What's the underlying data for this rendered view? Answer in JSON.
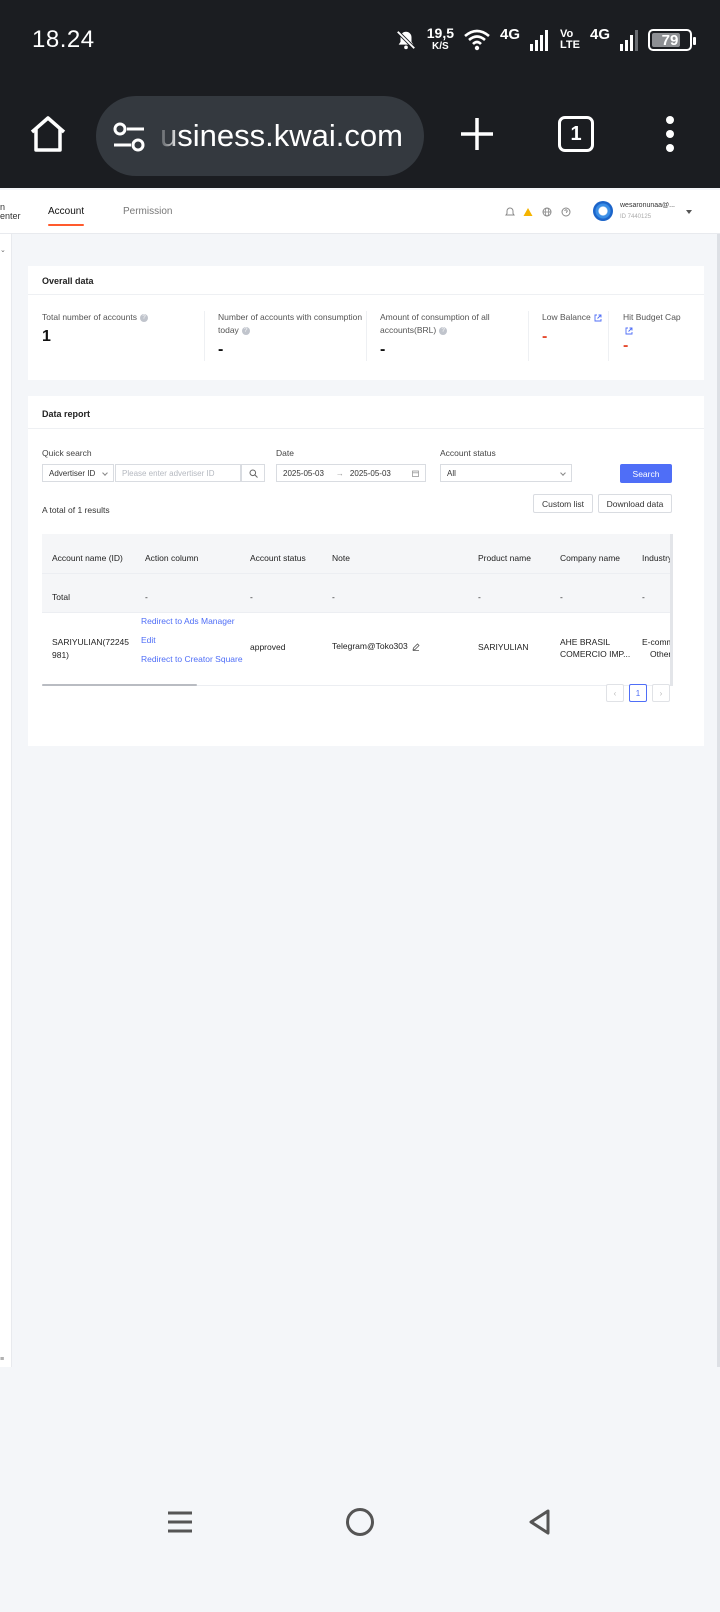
{
  "status_bar": {
    "time": "18.24",
    "speed_value": "19,5",
    "speed_unit": "K/S",
    "network1": "4G",
    "volte_top": "Vo",
    "volte_bottom": "LTE",
    "network2": "4G",
    "battery": "79",
    "battery_level": 0.79
  },
  "browser": {
    "url": "usiness.kwai.com",
    "tab_count": "1"
  },
  "header": {
    "logo_line1": "n",
    "logo_line2": "enter",
    "tabs": [
      {
        "label": "Account",
        "active": true
      },
      {
        "label": "Permission",
        "active": false
      }
    ],
    "user_email": "wesaronunaa@...",
    "user_id": "ID 7440125",
    "accent_color": "#ff5a2d"
  },
  "overview": {
    "title": "Overall data",
    "stats": [
      {
        "label": "Total number of accounts",
        "value": "1"
      },
      {
        "label": "Number of accounts with consumption today",
        "value": "-"
      },
      {
        "label": "Amount of consumption of all accounts(BRL)",
        "value": "-"
      },
      {
        "label": "Low Balance",
        "value": "-"
      },
      {
        "label": "Hit Budget Cap",
        "value": "-"
      }
    ]
  },
  "report": {
    "title": "Data report",
    "quick_search_label": "Quick search",
    "search_type": "Advertiser ID",
    "search_placeholder": "Please enter advertiser ID",
    "date_label": "Date",
    "date_start": "2025-05-03",
    "date_separator": "→",
    "date_end": "2025-05-03",
    "status_label": "Account status",
    "status_value": "All",
    "search_button": "Search",
    "result_count": "A total of 1 results",
    "custom_list_button": "Custom list",
    "download_button": "Download data",
    "primary_color": "#4f6ef7",
    "columns": [
      "Account name (ID)",
      "Action column",
      "Account status",
      "Note",
      "Product name",
      "Company name",
      "Industry"
    ],
    "total_row": {
      "label": "Total",
      "values": [
        "-",
        "-",
        "-",
        "-",
        "-",
        "-"
      ]
    },
    "rows": [
      {
        "account_name_line1": "SARIYULIAN(72245",
        "account_name_line2": "981)",
        "actions": [
          "Redirect to Ads Manager",
          "Edit",
          "Redirect to Creator Square"
        ],
        "status": "approved",
        "note": "Telegram@Toko303",
        "product": "SARIYULIAN",
        "company_line1": "AHE BRASIL",
        "company_line2": "COMERCIO IMP...",
        "industry_line1": "E-comm",
        "industry_line2": "Other"
      }
    ],
    "pagination": {
      "prev": "‹",
      "current": "1",
      "next": "›"
    }
  }
}
